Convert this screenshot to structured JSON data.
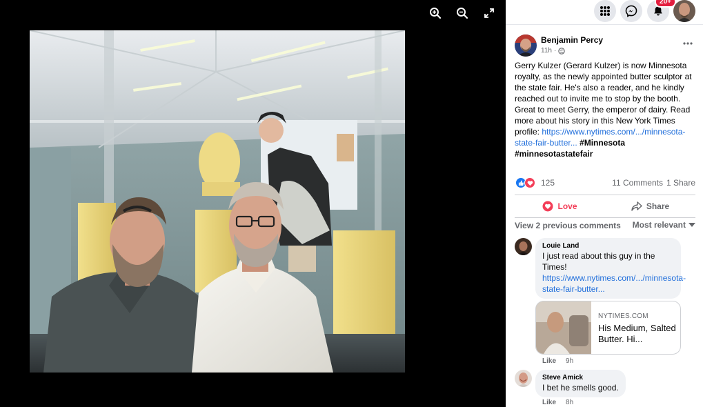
{
  "viewer": {
    "tools": [
      {
        "name": "zoom-in-icon"
      },
      {
        "name": "zoom-out-icon"
      },
      {
        "name": "expand-icon"
      }
    ]
  },
  "topbar": {
    "menu_icon": "grid-menu-icon",
    "messenger_icon": "messenger-icon",
    "notifications_icon": "bell-icon",
    "notification_badge": "20+"
  },
  "post": {
    "author": "Benjamin Percy",
    "time": "11h",
    "separator": "·",
    "privacy_icon": "globe-icon",
    "text": "Gerry Kulzer (Gerard Kulzer) is now Minnesota royalty, as the newly appointed butter sculptor at the state fair. He's also a reader, and he kindly reached out to invite me to stop by the booth. Great to meet Gerry, the emperor of dairy. Read more about his story in this New York Times profile: ",
    "link": "https://www.nytimes.com/.../minnesota-state-fair-butter...",
    "hashtag1": "#Minnesota",
    "hashtag2": "#minnesotastatefair",
    "reaction_count": "125",
    "comments_count": "11 Comments",
    "shares_count": "1 Share",
    "love_label": "Love",
    "share_label": "Share"
  },
  "comments_header": {
    "view_previous": "View 2 previous comments",
    "sort": "Most relevant"
  },
  "comments": [
    {
      "name": "Louie Land",
      "text": "I just read about this guy in the Times!",
      "link": "https://www.nytimes.com/.../minnesota-state-fair-butter...",
      "card_site": "NYTIMES.COM",
      "card_title": "His Medium, Salted Butter. Hi...",
      "like": "Like",
      "time": "9h"
    },
    {
      "name": "Steve Amick",
      "text": "I bet he smells good.",
      "like": "Like",
      "time": "8h"
    }
  ],
  "colors": {
    "accent": "#1877f2",
    "love": "#f33e58",
    "link": "#216fdb",
    "badge": "#e41e3f"
  }
}
